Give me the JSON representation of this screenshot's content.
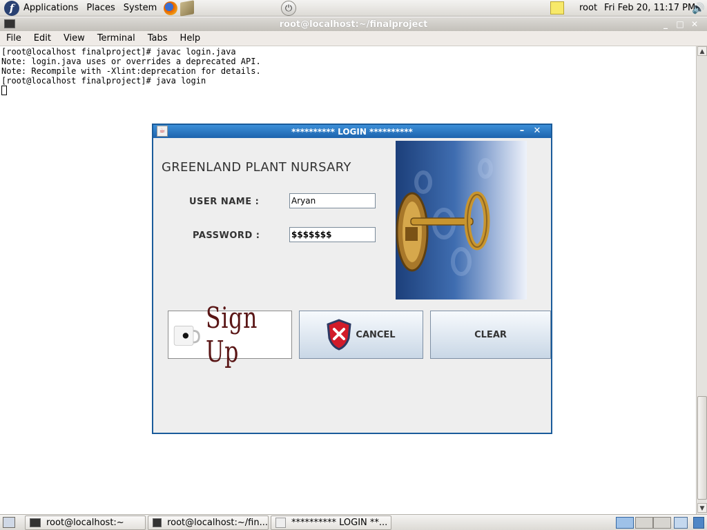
{
  "top_panel": {
    "menus": [
      "Applications",
      "Places",
      "System"
    ],
    "user": "root",
    "clock": "Fri Feb 20, 11:17 PM"
  },
  "terminal": {
    "title": "root@localhost:~/finalproject",
    "menu": [
      "File",
      "Edit",
      "View",
      "Terminal",
      "Tabs",
      "Help"
    ],
    "lines": [
      "[root@localhost finalproject]# javac login.java",
      "Note: login.java uses or overrides a deprecated API.",
      "Note: Recompile with -Xlint:deprecation for details.",
      "[root@localhost finalproject]# java login"
    ]
  },
  "login": {
    "title": "********** LOGIN **********",
    "heading": "GREENLAND PLANT NURSARY",
    "username_label": "USER NAME :",
    "username_value": "Aryan",
    "password_label": "PASSWORD :",
    "password_value": "$$$$$$$",
    "signup_label": "Sign Up",
    "cancel_label": "CANCEL",
    "clear_label": "CLEAR"
  },
  "taskbar": {
    "tasks": [
      "root@localhost:~",
      "root@localhost:~/fin...",
      "********** LOGIN **..."
    ]
  }
}
